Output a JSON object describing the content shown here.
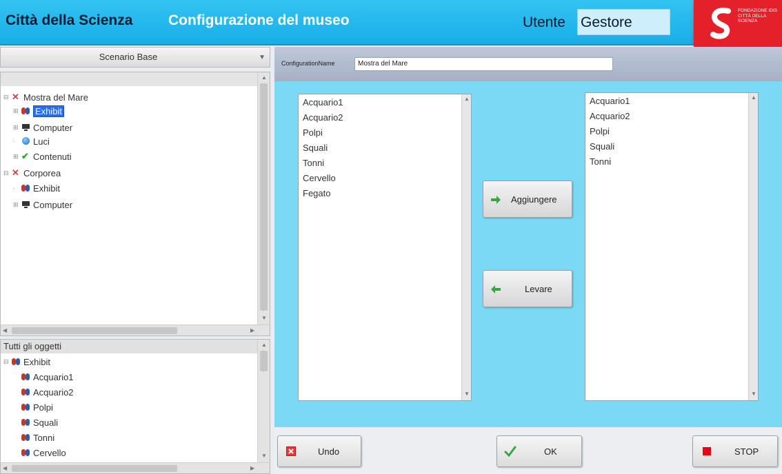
{
  "header": {
    "app_title": "Città della Scienza",
    "page_title": "Configurazione del museo",
    "user_label": "Utente",
    "user_value": "Gestore",
    "logo_text": "Fondazione IDIS Città della Scienza"
  },
  "scenario": {
    "label": "Scenario Base"
  },
  "tree": {
    "nodes": [
      {
        "label": "Mostra del Mare",
        "icon": "x-icon"
      },
      {
        "label": "Exhibit",
        "icon": "butterfly-icon",
        "selected": true
      },
      {
        "label": "Computer",
        "icon": "computer-icon"
      },
      {
        "label": "Luci",
        "icon": "globe-icon"
      },
      {
        "label": "Contenuti",
        "icon": "check-icon"
      },
      {
        "label": "Corporea",
        "icon": "x-icon"
      },
      {
        "label": "Exhibit",
        "icon": "butterfly-icon"
      },
      {
        "label": "Computer",
        "icon": "computer-icon"
      }
    ]
  },
  "objects": {
    "header": "Tutti gli oggetti",
    "root": "Exhibit",
    "items": [
      "Acquario1",
      "Acquario2",
      "Polpi",
      "Squali",
      "Tonni",
      "Cervello"
    ]
  },
  "config": {
    "label": "ConfigurationName",
    "value": "Mostra del Mare"
  },
  "available_list": [
    "Acquario1",
    "Acquario2",
    "Polpi",
    "Squali",
    "Tonni",
    "Cervello",
    "Fegato"
  ],
  "selected_list": [
    "Acquario1",
    "Acquario2",
    "Polpi",
    "Squali",
    "Tonni"
  ],
  "buttons": {
    "add": "Aggiungere",
    "remove": "Levare",
    "undo": "Undo",
    "ok": "OK",
    "stop": "STOP"
  },
  "colors": {
    "header_bg": "#1fb5ea",
    "main_bg": "#7ad9f5",
    "logo_bg": "#e4202b",
    "selection": "#2a6df0"
  }
}
